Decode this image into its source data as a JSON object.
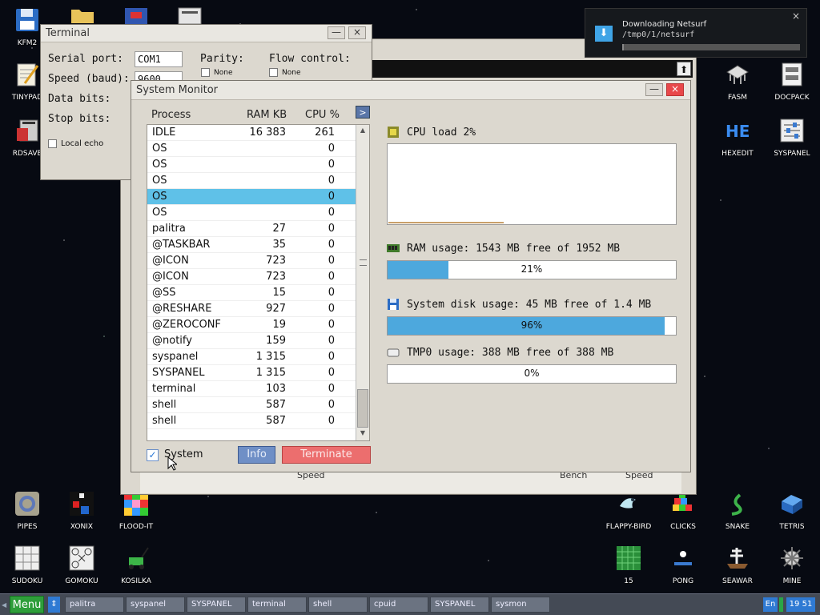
{
  "desktop_icons_left": [
    {
      "label": "KFM2",
      "icon": "floppy-icon"
    },
    {
      "label": "TINYPAD",
      "icon": "notepad-icon"
    },
    {
      "label": "RDSAVE",
      "icon": "rdsave-icon"
    }
  ],
  "desktop_icons_right": [
    {
      "label": "FASM",
      "icon": "fasm-icon"
    },
    {
      "label": "DOCPACK",
      "icon": "docpack-icon"
    },
    {
      "label": "HEXEDIT",
      "icon": "hexedit-icon"
    },
    {
      "label": "SYSPANEL",
      "icon": "syspanel-icon"
    }
  ],
  "desktop_icons_bottom": [
    {
      "label": "PIPES",
      "icon": "pipes-icon"
    },
    {
      "label": "XONIX",
      "icon": "xonix-icon"
    },
    {
      "label": "FLOOD-IT",
      "icon": "flood-it-icon"
    },
    {
      "label": "SUDOKU",
      "icon": "sudoku-icon"
    },
    {
      "label": "GOMOKU",
      "icon": "gomoku-icon"
    },
    {
      "label": "KOSILKA",
      "icon": "kosilka-icon"
    },
    {
      "label": "FLAPPY-BIRD",
      "icon": "flappy-bird-icon"
    },
    {
      "label": "CLICKS",
      "icon": "clicks-icon"
    },
    {
      "label": "SNAKE",
      "icon": "snake-icon"
    },
    {
      "label": "TETRIS",
      "icon": "tetris-icon"
    },
    {
      "label": "15",
      "icon": "fifteen-icon"
    },
    {
      "label": "PONG",
      "icon": "pong-icon"
    },
    {
      "label": "SEAWAR",
      "icon": "seawar-icon"
    },
    {
      "label": "MINE",
      "icon": "mine-icon"
    }
  ],
  "terminal": {
    "title": "Terminal",
    "serial_port_label": "Serial port:",
    "serial_port_value": "COM1",
    "speed_label": "Speed (baud):",
    "speed_value": "9600",
    "data_bits_label": "Data bits:",
    "stop_bits_label": "Stop bits:",
    "parity_label": "Parity:",
    "parity_none": "None",
    "flow_label": "Flow control:",
    "flow_none": "None",
    "local_echo": "Local echo",
    "minimize": "—",
    "close": "×"
  },
  "background_window": {
    "labels": [
      "Speed",
      "Bench",
      "Speed"
    ]
  },
  "sysmon": {
    "title": "System Monitor",
    "minimize": "—",
    "close": "×",
    "headers": {
      "process": "Process",
      "ram": "RAM KB",
      "cpu": "CPU %"
    },
    "header_arrow": ">",
    "processes": [
      {
        "name": "IDLE",
        "ram": "16 383",
        "cpu": "261"
      },
      {
        "name": "OS",
        "ram": "",
        "cpu": "0"
      },
      {
        "name": "OS",
        "ram": "",
        "cpu": "0"
      },
      {
        "name": "OS",
        "ram": "",
        "cpu": "0"
      },
      {
        "name": "OS",
        "ram": "",
        "cpu": "0",
        "selected": true
      },
      {
        "name": "OS",
        "ram": "",
        "cpu": "0"
      },
      {
        "name": "palitra",
        "ram": "27",
        "cpu": "0"
      },
      {
        "name": "@TASKBAR",
        "ram": "35",
        "cpu": "0"
      },
      {
        "name": "@ICON",
        "ram": "723",
        "cpu": "0"
      },
      {
        "name": "@ICON",
        "ram": "723",
        "cpu": "0"
      },
      {
        "name": "@SS",
        "ram": "15",
        "cpu": "0"
      },
      {
        "name": "@RESHARE",
        "ram": "927",
        "cpu": "0"
      },
      {
        "name": "@ZEROCONF",
        "ram": "19",
        "cpu": "0"
      },
      {
        "name": "@notify",
        "ram": "159",
        "cpu": "0"
      },
      {
        "name": "syspanel",
        "ram": "1 315",
        "cpu": "0"
      },
      {
        "name": "SYSPANEL",
        "ram": "1 315",
        "cpu": "0"
      },
      {
        "name": "terminal",
        "ram": "103",
        "cpu": "0"
      },
      {
        "name": "shell",
        "ram": "587",
        "cpu": "0"
      },
      {
        "name": "shell",
        "ram": "587",
        "cpu": "0"
      }
    ],
    "system_checkbox_label": "System",
    "system_checked": true,
    "info_label": "Info",
    "terminate_label": "Terminate",
    "cpu_load_label": "CPU load 2%",
    "cpu_load_fraction": 0.02,
    "ram_label": "RAM usage: 1543 MB free of 1952 MB",
    "ram_percent_text": "21%",
    "ram_fraction": 0.21,
    "disk_label": "System disk usage: 45 MB free of 1.4 MB",
    "disk_percent_text": "96%",
    "disk_fraction": 0.96,
    "tmp_label": "TMP0 usage: 388 MB free of 388 MB",
    "tmp_percent_text": "0%",
    "tmp_fraction": 0.0
  },
  "notification": {
    "title": "Downloading Netsurf",
    "path": "/tmp0/1/netsurf",
    "close": "×",
    "progress_fraction": 0.01
  },
  "taskbar": {
    "menu_label": "Menu",
    "switch_glyph": "⇕",
    "tasks": [
      "palitra",
      "syspanel",
      "SYSPANEL",
      "terminal",
      "shell",
      "cpuid",
      "SYSPANEL",
      "sysmon"
    ],
    "lang": "En",
    "clock": "19 51"
  },
  "colors": {
    "selection": "#5fc1e8",
    "bar_fill": "#4da8dd",
    "terminate": "#ec6e6e",
    "info": "#6f8fc6",
    "menu": "#2e9e3a"
  }
}
